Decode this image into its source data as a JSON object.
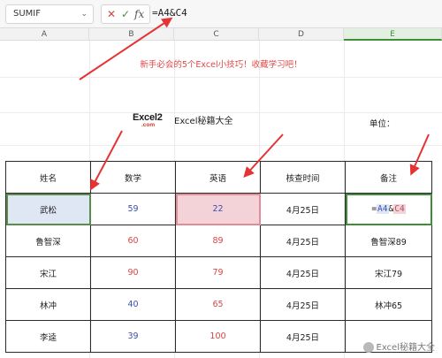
{
  "formula_bar": {
    "name_box": "SUMIF",
    "cancel_icon": "✕",
    "confirm_icon": "✓",
    "fx_icon": "fx",
    "formula": "=A4&C4"
  },
  "columns": [
    {
      "label": "A"
    },
    {
      "label": "B"
    },
    {
      "label": "C"
    },
    {
      "label": "D"
    },
    {
      "label": "E"
    }
  ],
  "sheet": {
    "title": "新手必会的5个Excel小技巧！收藏学习吧！",
    "logo_main": "Excel2",
    "logo_sub": ".com",
    "brand_name": "Excel秘籍大全",
    "unit_label": "单位："
  },
  "table": {
    "headers": [
      "姓名",
      "数学",
      "英语",
      "核查时间",
      "备注"
    ],
    "rows": [
      {
        "name": "武松",
        "math": "59",
        "eng": "22",
        "date": "4月25日",
        "note": ""
      },
      {
        "name": "鲁智深",
        "math": "60",
        "eng": "89",
        "date": "4月25日",
        "note": "鲁智深89"
      },
      {
        "name": "宋江",
        "math": "90",
        "eng": "79",
        "date": "4月25日",
        "note": "宋江79"
      },
      {
        "name": "林冲",
        "math": "40",
        "eng": "65",
        "date": "4月25日",
        "note": "林冲65"
      },
      {
        "name": "李逵",
        "math": "39",
        "eng": "100",
        "date": "4月25日",
        "note": ""
      }
    ],
    "editing_formula": {
      "prefix": "=",
      "ref_a": "A4",
      "amp": "&",
      "ref_c": "C4"
    }
  },
  "colors": {
    "accent_red": "#e04848",
    "ref_blue": "#3a4fb0",
    "ref_pink": "#f4d3d8",
    "selection_green": "#3f8f3a"
  },
  "watermark": "Excel秘籍大全"
}
